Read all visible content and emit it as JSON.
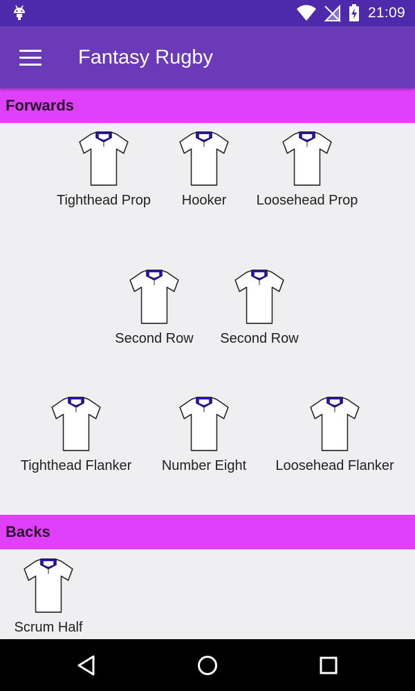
{
  "status_bar": {
    "time": "21:09",
    "icons": [
      "android-icon",
      "wifi-icon",
      "no-sim-icon",
      "battery-charging-icon"
    ]
  },
  "app_bar": {
    "menu_icon": "hamburger-menu-icon",
    "title": "Fantasy Rugby"
  },
  "sections": {
    "forwards": {
      "title": "Forwards",
      "players": [
        "Tighthead Prop",
        "Hooker",
        "Loosehead Prop",
        "Second Row",
        "Second Row",
        "Tighthead Flanker",
        "Number Eight",
        "Loosehead Flanker"
      ]
    },
    "backs": {
      "title": "Backs",
      "players": [
        "Scrum Half"
      ]
    }
  },
  "shirt_colors": {
    "body": "#ffffff",
    "collar": "#2a10c8",
    "outline": "#222222"
  },
  "navigation": {
    "back_icon": "back-triangle-icon",
    "home_icon": "home-circle-icon",
    "recents_icon": "recents-square-icon"
  }
}
